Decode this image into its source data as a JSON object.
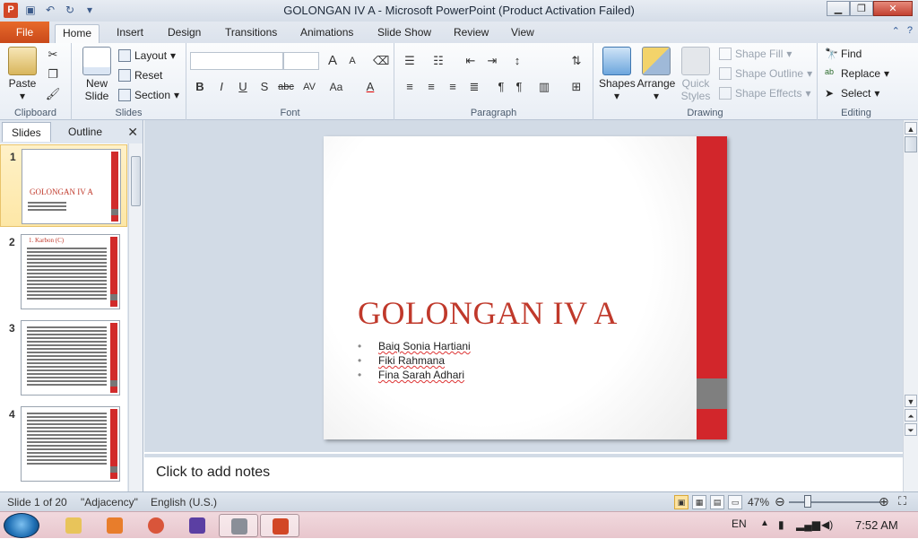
{
  "window": {
    "title": "GOLONGAN IV A  -  Microsoft PowerPoint (Product Activation Failed)",
    "app_letter": "P"
  },
  "ribbon_tabs": [
    {
      "label": "File"
    },
    {
      "label": "Home"
    },
    {
      "label": "Insert"
    },
    {
      "label": "Design"
    },
    {
      "label": "Transitions"
    },
    {
      "label": "Animations"
    },
    {
      "label": "Slide Show"
    },
    {
      "label": "Review"
    },
    {
      "label": "View"
    }
  ],
  "ribbon": {
    "clipboard": {
      "paste": "Paste",
      "label": "Clipboard"
    },
    "slides": {
      "new_slide_1": "New",
      "new_slide_2": "Slide",
      "layout": "Layout",
      "reset": "Reset",
      "section": "Section",
      "label": "Slides"
    },
    "font": {
      "label": "Font",
      "bold": "B",
      "italic": "I",
      "underline": "U",
      "shadow": "S",
      "strike": "abc",
      "spacing": "AV",
      "case": "Aa",
      "color": "A",
      "grow": "A",
      "shrink": "A"
    },
    "paragraph": {
      "label": "Paragraph"
    },
    "drawing": {
      "shapes": "Shapes",
      "arrange": "Arrange",
      "quick_1": "Quick",
      "quick_2": "Styles",
      "shape_fill": "Shape Fill",
      "shape_outline": "Shape Outline",
      "shape_effects": "Shape Effects",
      "label": "Drawing"
    },
    "editing": {
      "find": "Find",
      "replace": "Replace",
      "select": "Select",
      "label": "Editing"
    }
  },
  "left_pane": {
    "tabs": [
      {
        "label": "Slides"
      },
      {
        "label": "Outline"
      }
    ],
    "close": "✕"
  },
  "thumbnails": [
    {
      "num": "1",
      "title": "GOLONGAN IV A"
    },
    {
      "num": "2",
      "title": "1. Karbon (C)"
    },
    {
      "num": "3",
      "title": ""
    },
    {
      "num": "4",
      "title": ""
    }
  ],
  "slide": {
    "title": "GOLONGAN IV A",
    "bullets": [
      "Baiq Sonia Hartiani",
      "Fiki Rahmana",
      "Fina Sarah Adhari"
    ],
    "accent_color": "#d2262b"
  },
  "notes": {
    "placeholder": "Click to add notes"
  },
  "status": {
    "slide": "Slide 1 of 20",
    "theme": "\"Adjacency\"",
    "language": "English (U.S.)",
    "zoom": "47%"
  },
  "taskbar": {
    "lang": "EN",
    "time": "7:52 AM"
  }
}
